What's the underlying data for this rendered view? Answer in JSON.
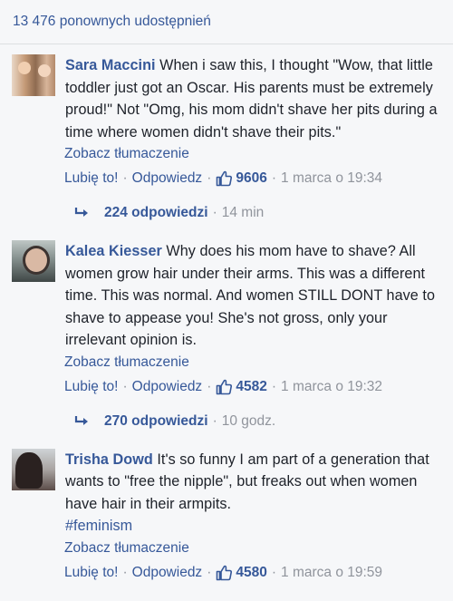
{
  "shares_label": "13 476 ponownych udostępnień",
  "comments": [
    {
      "author": "Sara Maccini",
      "text": " When i saw this, I thought \"Wow, that little toddler just got an Oscar. His parents must be extremely proud!\" Not \"Omg, his mom didn't shave her pits during a time where women didn't shave their pits.\"",
      "hashtag": "",
      "translate": "Zobacz tłumaczenie",
      "like": "Lubię to!",
      "reply": "Odpowiedz",
      "likes_count": "9606",
      "timestamp": "1 marca o 19:34",
      "replies_count": "224 odpowiedzi",
      "replies_time": "14 min"
    },
    {
      "author": "Kalea Kiesser",
      "text": " Why does his mom have to shave? All women grow hair under their arms. This was a different time. This was normal. And women STILL DONT have to shave to appease you! She's not gross, only your irrelevant opinion is.",
      "hashtag": "",
      "translate": "Zobacz tłumaczenie",
      "like": "Lubię to!",
      "reply": "Odpowiedz",
      "likes_count": "4582",
      "timestamp": "1 marca o 19:32",
      "replies_count": "270 odpowiedzi",
      "replies_time": "10 godz."
    },
    {
      "author": "Trisha Dowd",
      "text": " It's so funny I am part of a generation that wants to \"free the nipple\", but freaks out when women have hair in their armpits.",
      "hashtag": "#feminism",
      "translate": "Zobacz tłumaczenie",
      "like": "Lubię to!",
      "reply": "Odpowiedz",
      "likes_count": "4580",
      "timestamp": "1 marca o 19:59"
    }
  ],
  "colors": {
    "link": "#365899",
    "meta": "#90949c",
    "text": "#1d2129",
    "background": "#f6f7f9"
  },
  "icons": {
    "like": "thumbs-up-icon",
    "reply": "reply-arrow-icon"
  }
}
